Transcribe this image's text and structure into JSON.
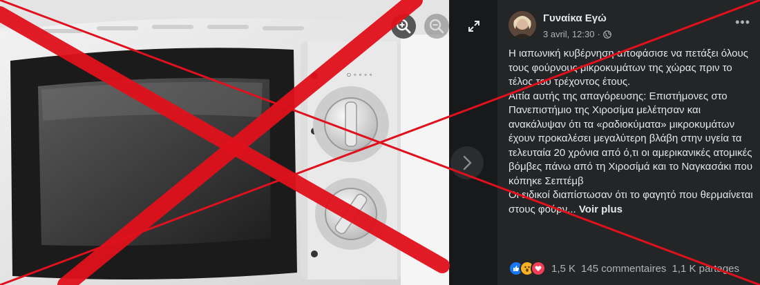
{
  "post": {
    "author": "Γυναίκα Εγώ",
    "date": "3 avril, 12:30",
    "separator": "·",
    "more_label": "•••",
    "paragraphs": [
      "Η ιαπωνική κυβέρνηση αποφάσισε να πετάξει όλους τους φούρνους μικροκυμάτων της χώρας πριν το τέλος του τρέχοντος έτους.",
      "Αιτία αυτής της απαγόρευσης: Επιστήμονες στο Πανεπιστήμιο της Χιροσίμα μελέτησαν και ανακάλυψαν ότι τα «ραδιοκύματα» μικροκυμάτων έχουν προκαλέσει μεγαλύτερη βλάβη στην υγεία τα τελευταία 20 χρόνια από ό,τι οι αμερικανικές ατομικές βόμβες πάνω από τη Χιροσίμά και το Ναγκασάκι που κόπηκε Σεπτέμβ",
      "Οι ειδικοί διαπίστωσαν ότι το φαγητό που θερμαίνεται στους φούρν..."
    ],
    "see_more": "Voir plus",
    "reactions_count": "1,5 K",
    "comments": "145 commentaires",
    "shares": "1,1 K partages"
  },
  "icons": {
    "zoom_in": "zoom-in-icon",
    "zoom_out": "zoom-out-icon",
    "expand": "expand-icon",
    "next": "chevron-right-icon",
    "globe": "globe-icon",
    "reactions": [
      "like-icon",
      "wow-icon",
      "love-icon"
    ]
  },
  "colors": {
    "cross": "#e0111c",
    "panel": "#242526",
    "text": "#e4e6eb",
    "secondary": "#b0b3b8",
    "like": "#1877f2",
    "wow": "#f7b125",
    "love": "#f33e58"
  }
}
